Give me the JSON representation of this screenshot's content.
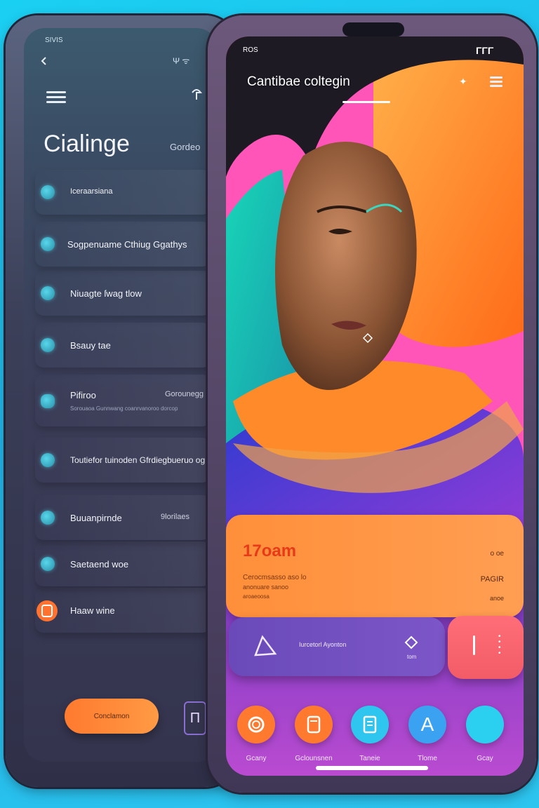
{
  "left_phone": {
    "status_left": "SIVIS",
    "status_right": "Ψ ᯤ",
    "title": "Cialinge",
    "title_aux": "Gordeo",
    "list": [
      {
        "label": "Iceraarsiana",
        "aux": "",
        "sub": ""
      },
      {
        "label": "Sogpenuame Cthiug Ggathys",
        "aux": "",
        "sub": ""
      },
      {
        "label": "Niuagte ſwag tlow",
        "aux": "",
        "sub": ""
      },
      {
        "label": "Bsauy tae",
        "aux": "",
        "sub": ""
      },
      {
        "label": "Pifiroo",
        "aux": "Gorounegg",
        "sub": "Sorouaoa Gunnwang coanrvanoroo dorcop"
      },
      {
        "label": "Toutiefor tuinoden Gfrdiegbueruo og",
        "aux": "",
        "sub": ""
      },
      {
        "label": "Buuanpirnde",
        "aux": "9lorilaes",
        "sub": ""
      },
      {
        "label": "Saetaend woe",
        "aux": "",
        "sub": ""
      },
      {
        "label": "Haaw wine",
        "aux": "",
        "sub": ""
      }
    ],
    "primary_button": "Conclamon"
  },
  "right_phone": {
    "status_left": "ROS",
    "status_right": "ΓΓΓ",
    "header_title": "Cantibae coltegin",
    "stat_card": {
      "value": "17oam",
      "right_top": "o oe",
      "subtitle": "Cerocmsasso aso lo",
      "sub2": "anonuare sanoo",
      "sub3": "aroaeoosa",
      "right_mid": "PAGIR",
      "right_bot": "anoe"
    },
    "action_card": {
      "label": "Iurcetorl Ayonton",
      "small": "tom"
    },
    "bottom_nav": [
      {
        "label": "Gcany",
        "icon": "ring-icon",
        "color": "#ff7a2e"
      },
      {
        "label": "Gclounsnen",
        "icon": "tablet-icon",
        "color": "#ff7a2e"
      },
      {
        "label": "Taneie",
        "icon": "document-icon",
        "color": "#2ec6ee"
      },
      {
        "label": "Tlome",
        "icon": "letter-a-icon",
        "color": "#3aa2f0"
      },
      {
        "label": "Gcay",
        "icon": "circle-icon",
        "color": "#2bd0f0"
      }
    ]
  }
}
